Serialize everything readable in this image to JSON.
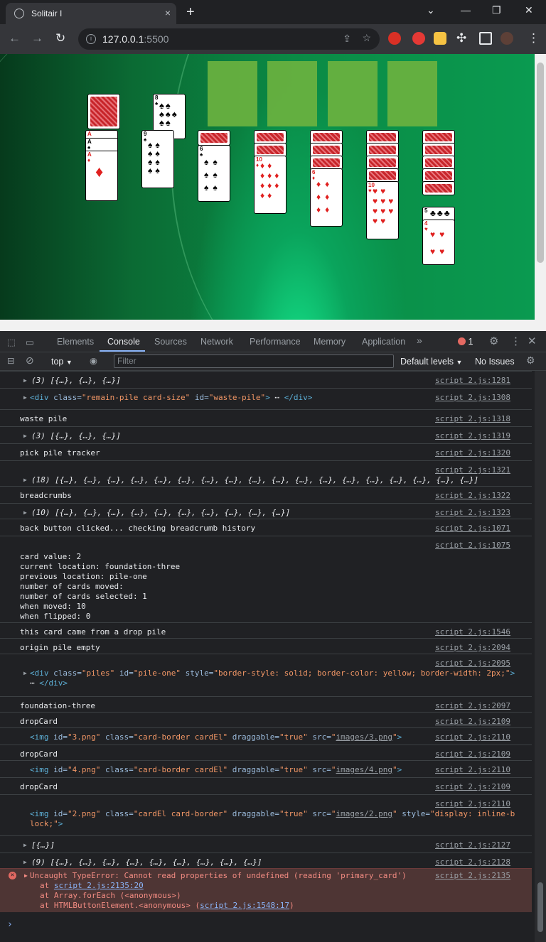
{
  "browser": {
    "tab_title": "Solitair I",
    "tab_close": "×",
    "new_tab": "+",
    "url_host": "127.0.0.1",
    "url_port": ":5500",
    "window_controls": [
      "⌄",
      "—",
      "❐",
      "✕"
    ]
  },
  "devtools": {
    "tabs": [
      "Elements",
      "Console",
      "Sources",
      "Network",
      "Performance",
      "Memory",
      "Application"
    ],
    "active_tab": "Console",
    "more": "»",
    "error_count": "1",
    "context": "top",
    "filter_placeholder": "Filter",
    "levels": "Default levels",
    "issues": "No Issues"
  },
  "game": {
    "foundation_count": 4,
    "stock": "card back",
    "waste_top": "8 of spades"
  },
  "console": {
    "rows": [
      {
        "text": "(3) [{…}, {…}, {…}]",
        "src": "script 2.js:1281",
        "expand": true,
        "italic": true
      },
      {
        "text": "",
        "src": "script 2.js:1308",
        "html": "remain"
      },
      {
        "text": "waste pile",
        "src": "script 2.js:1318"
      },
      {
        "text": "(3) [{…}, {…}, {…}]",
        "src": "script 2.js:1319",
        "expand": true,
        "italic": true
      },
      {
        "text": "pick pile tracker",
        "src": "script 2.js:1320"
      },
      {
        "text": "(18) [{…}, {…}, {…}, {…}, {…}, {…}, {…}, {…}, {…}, {…}, {…}, {…}, {…}, {…}, {…}, {…}, {…}, {…}]",
        "src": "script 2.js:1321",
        "expand": true,
        "italic": true
      },
      {
        "text": "breadcrumbs",
        "src": "script 2.js:1322"
      },
      {
        "text": "(10) [{…}, {…}, {…}, {…}, {…}, {…}, {…}, {…}, {…}, {…}]",
        "src": "script 2.js:1323",
        "expand": true,
        "italic": true
      },
      {
        "text": "back button clicked... checking breadcrumb history",
        "src": "script 2.js:1071"
      },
      {
        "text": "card value: 2\ncurrent location: foundation-three\nprevious location: pile-one\nnumber of cards moved:\nnumber of cards selected: 1\nwhen moved: 10\nwhen flipped: 0",
        "src": "script 2.js:1075"
      },
      {
        "text": "this card came from a drop pile",
        "src": "script 2.js:1546"
      },
      {
        "text": "origin pile empty",
        "src": "script 2.js:2094"
      },
      {
        "text": "",
        "src": "script 2.js:2095",
        "html": "pile"
      },
      {
        "text": "foundation-three",
        "src": "script 2.js:2097"
      },
      {
        "text": "dropCard",
        "src": "script 2.js:2109"
      },
      {
        "text": "",
        "src": "script 2.js:2110",
        "html": "img3"
      },
      {
        "text": "dropCard",
        "src": "script 2.js:2109"
      },
      {
        "text": "",
        "src": "script 2.js:2110",
        "html": "img4"
      },
      {
        "text": "dropCard",
        "src": "script 2.js:2109"
      },
      {
        "text": "",
        "src": "script 2.js:2110",
        "html": "img2"
      },
      {
        "text": "[{…}]",
        "src": "script 2.js:2127",
        "expand": true,
        "italic": true
      },
      {
        "text": "(9) [{…}, {…}, {…}, {…}, {…}, {…}, {…}, {…}, {…}]",
        "src": "script 2.js:2128",
        "expand": true,
        "italic": true
      }
    ],
    "error": {
      "message": "Uncaught TypeError: Cannot read properties of undefined (reading 'primary_card')",
      "src": "script 2.js:2135",
      "stack_prefix_1": "at ",
      "stack_link_1": "script 2.js:2135:20",
      "stack_2": "at Array.forEach (<anonymous>)",
      "stack_prefix_3": "at HTMLButtonElement.<anonymous> (",
      "stack_link_3": "script 2.js:1548:17",
      "stack_suffix_3": ")"
    },
    "html_snippets": {
      "remain": {
        "open": "<div ",
        "class_attr": "class=",
        "class_val": "\"remain-pile card-size\"",
        "id_attr": " id=",
        "id_val": "\"waste-pile\"",
        "close": ">",
        "end": "</div>"
      },
      "pile": {
        "line1_open": "<div ",
        "class_attr": "class=",
        "class_val": "\"piles\"",
        "id_attr": " id=",
        "id_val": "\"pile-one\"",
        "style_attr": " style=",
        "style_val": "\"border-style: solid; border-color: yellow; border-width: 2px;\"",
        "close": ">",
        "end": "</div>"
      },
      "img3": {
        "open": "<img ",
        "id": "id=",
        "id_val": "\"3.png\"",
        "cls": " class=",
        "cls_val": "\"card-border cardEl\"",
        "drag": " draggable=",
        "drag_val": "\"true\"",
        "src": " src=",
        "src_val": "images/3.png",
        "close": ">"
      },
      "img4": {
        "open": "<img ",
        "id": "id=",
        "id_val": "\"4.png\"",
        "cls": " class=",
        "cls_val": "\"card-border cardEl\"",
        "drag": " draggable=",
        "drag_val": "\"true\"",
        "src": " src=",
        "src_val": "images/4.png",
        "close": ">"
      },
      "img2": {
        "open": "<img ",
        "id": "id=",
        "id_val": "\"2.png\"",
        "cls": " class=",
        "cls_val": "\"cardEl card-border\"",
        "drag": " draggable=",
        "drag_val": "\"true\"",
        "src": " src=",
        "src_val": "images/2.png",
        "style": " style=",
        "style_val_1": "\"display: inline-b",
        "style_val_2": "lock;\"",
        "close": ">"
      }
    },
    "prompt": "›"
  }
}
